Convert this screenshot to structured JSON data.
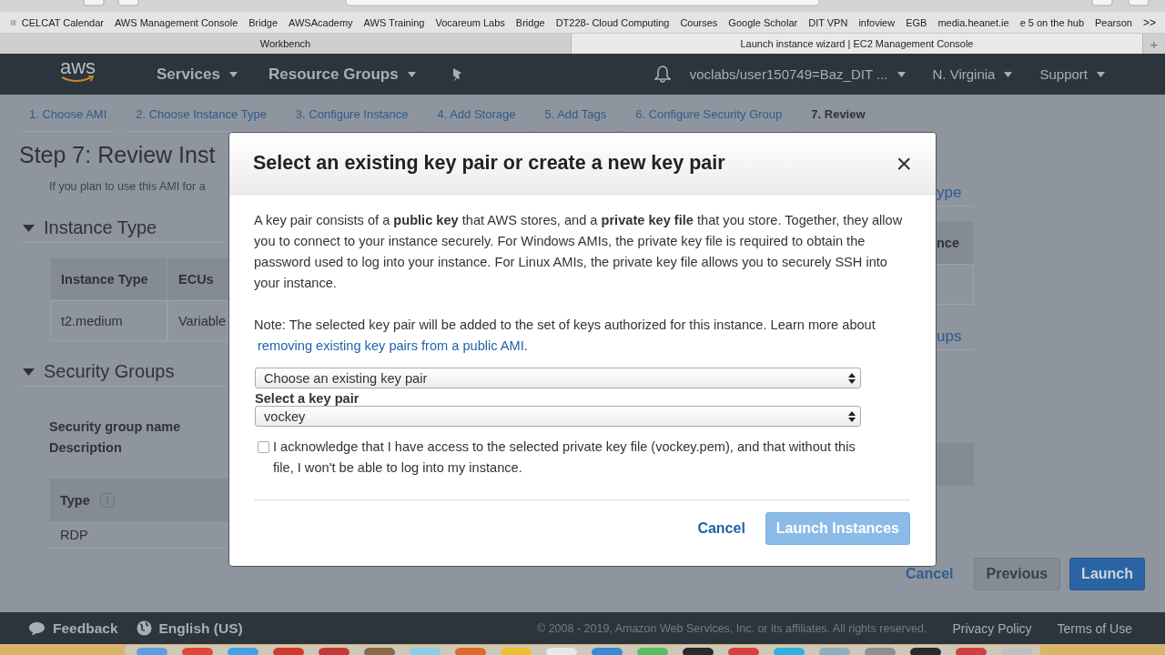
{
  "browser": {
    "bookmarks": [
      "CELCAT Calendar",
      "AWS Management Console",
      "Bridge",
      "AWSAcademy",
      "AWS Training",
      "Vocareum Labs",
      "Bridge",
      "DT228- Cloud Computing",
      "Courses",
      "Google Scholar",
      "DIT VPN",
      "infoview",
      "EGB",
      "media.heanet.ie",
      "e 5 on the hub",
      "Pearson"
    ],
    "overflow": ">>",
    "tabs": [
      {
        "title": "Workbench",
        "selected": false
      },
      {
        "title": "Launch instance wizard | EC2 Management Console",
        "selected": true
      }
    ],
    "new_tab": "+"
  },
  "nav": {
    "logo": "aws",
    "menus": [
      "Services",
      "Resource Groups"
    ],
    "account": "voclabs/user150749=Baz_DIT ...",
    "region": "N. Virginia",
    "support": "Support"
  },
  "steps": [
    {
      "label": "1. Choose AMI",
      "selected": false
    },
    {
      "label": "2. Choose Instance Type",
      "selected": false
    },
    {
      "label": "3. Configure Instance",
      "selected": false
    },
    {
      "label": "4. Add Storage",
      "selected": false
    },
    {
      "label": "5. Add Tags",
      "selected": false
    },
    {
      "label": "6. Configure Security Group",
      "selected": false
    },
    {
      "label": "7. Review",
      "selected": true
    }
  ],
  "page": {
    "title": "Step 7: Review Inst",
    "subtitle": "If you plan to use this AMI for a",
    "instance_section": {
      "title": "Instance Type",
      "edit_link": "ype",
      "columns": [
        "Instance Type",
        "ECUs",
        "nce"
      ],
      "row": [
        "t2.medium",
        "Variable"
      ]
    },
    "security_section": {
      "title": "Security Groups",
      "edit_link": "ups",
      "fields": [
        "Security group name",
        "Description"
      ],
      "columns": [
        "Type"
      ],
      "row": [
        "RDP"
      ]
    },
    "buttons": {
      "cancel": "Cancel",
      "previous": "Previous",
      "launch": "Launch"
    }
  },
  "modal": {
    "title": "Select an existing key pair or create a new key pair",
    "close": "×",
    "intro": "A key pair consists of a **public key** that AWS stores, and a **private key file** that you store. Together, they allow you to connect to your instance securely. For Windows AMIs, the private key file is required to obtain the password used to log into your instance. For Linux AMIs, the private key file allows you to securely SSH into your instance.",
    "note": {
      "text": "Note: The selected key pair will be added to the set of keys authorized for this instance. Learn more about ",
      "link": "removing existing key pairs from a public AMI",
      "after": "."
    },
    "mode_select": "Choose an existing key pair",
    "key_label": "Select a key pair",
    "key_select": "vockey",
    "acknowledge": {
      "checked": false,
      "text": "I acknowledge that I have access to the selected private key file (vockey.pem), and that without this file, I won't be able to log into my instance."
    },
    "cancel": "Cancel",
    "launch": {
      "label": "Launch Instances",
      "disabled": true
    }
  },
  "footer": {
    "feedback": "Feedback",
    "language": "English (US)",
    "copyright": "© 2008 - 2019, Amazon Web Services, Inc. or its affiliates. All rights reserved.",
    "links": [
      "Privacy Policy",
      "Terms of Use"
    ]
  }
}
